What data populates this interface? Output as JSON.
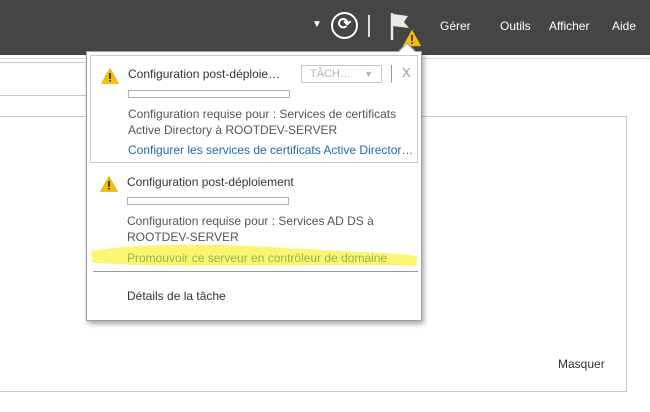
{
  "toolbar": {
    "menu": [
      "Gérer",
      "Outils",
      "Afficher",
      "Aide"
    ],
    "icons": [
      "chevron-down-icon",
      "refresh-icon",
      "flag-icon",
      "warning-icon"
    ]
  },
  "notifications": {
    "tasks": [
      {
        "title": "Configuration post-déploie…",
        "button_label": "TÂCH…",
        "close_label": "X",
        "progress": 0,
        "description": "Configuration requise pour : Services de certificats Active Directory à ROOTDEV-SERVER",
        "link": "Configurer les services de certificats Active Director…"
      },
      {
        "title": "Configuration post-déploiement",
        "progress": 0,
        "description": "Configuration requise pour : Services AD DS à ROOTDEV-SERVER",
        "link": "Promouvoir ce serveur en contrôleur de domaine"
      }
    ],
    "details_link": "Détails de la tâche"
  },
  "panel": {
    "hide_link": "Masquer"
  },
  "colors": {
    "topbar": "#454545",
    "warning": "#f5c000",
    "link": "#1e6aa6",
    "highlight": "#f5ee00"
  }
}
